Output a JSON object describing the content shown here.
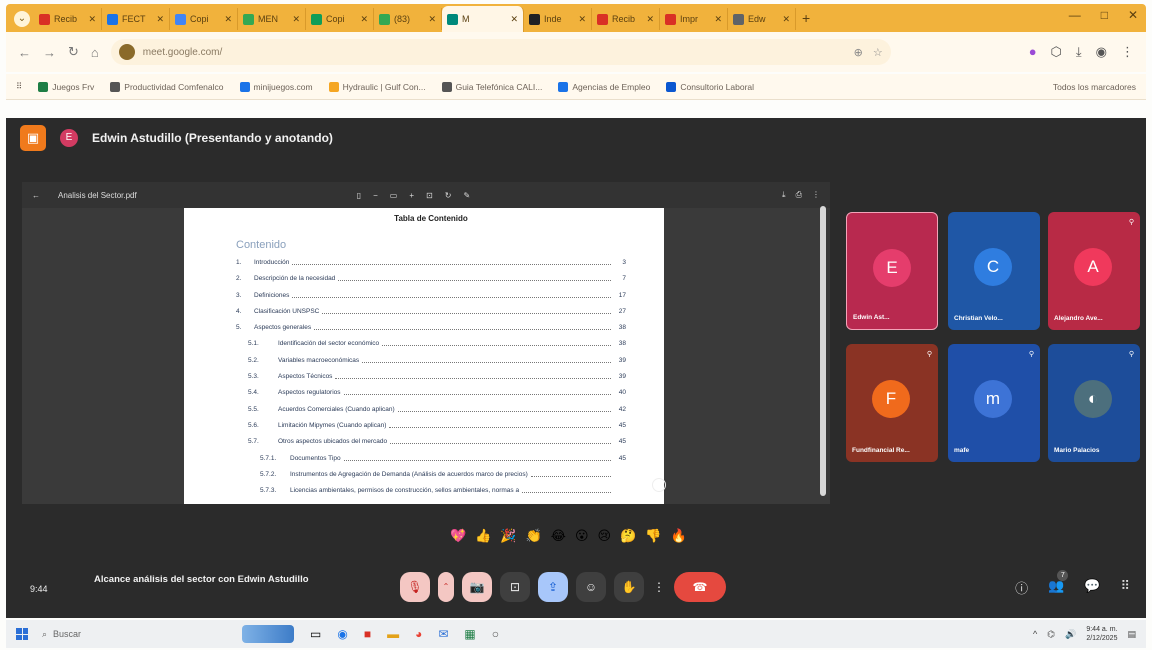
{
  "browser": {
    "tabs": [
      {
        "title": "Recib",
        "color": "#d93025"
      },
      {
        "title": "FECT",
        "color": "#1a73e8"
      },
      {
        "title": "Copi",
        "color": "#4285f4"
      },
      {
        "title": "MEN",
        "color": "#34a853"
      },
      {
        "title": "Copi",
        "color": "#0f9d58"
      },
      {
        "title": "(83)",
        "color": "#34a853"
      },
      {
        "title": "M",
        "color": "#00897b",
        "active": true
      },
      {
        "title": "Inde",
        "color": "#202124"
      },
      {
        "title": "Recib",
        "color": "#d93025"
      },
      {
        "title": "Impr",
        "color": "#d93025"
      },
      {
        "title": "Edw",
        "color": "#5f6368"
      }
    ],
    "url": "meet.google.com/",
    "bookmarks": [
      "Juegos Frv",
      "Productividad Comfenalco",
      "minijuegos.com",
      "Hydraulic | Gulf Con...",
      "Guia Telefónica CALI...",
      "Agencias de Empleo",
      "Consultorio Laboral"
    ],
    "bookmarks_right": "Todos los marcadores"
  },
  "meet": {
    "presenter": "Edwin Astudillo (Presentando y anotando)",
    "presenter_initial": "E",
    "pdf_title": "Analisis del Sector.pdf",
    "meeting_title": "Alcance análisis del sector con Edwin Astudillo",
    "time": "9:44",
    "reactions": [
      "💖",
      "👍",
      "🎉",
      "👏",
      "😂",
      "😮",
      "😢",
      "🤔",
      "👎",
      "🔥"
    ],
    "people_count": "7"
  },
  "document": {
    "page_title": "Tabla de Contenido",
    "heading": "Contenido",
    "toc": [
      {
        "num": "1.",
        "text": "Introducción",
        "page": "3",
        "level": 1
      },
      {
        "num": "2.",
        "text": "Descripción de la necesidad",
        "page": "7",
        "level": 1
      },
      {
        "num": "3.",
        "text": "Definiciones",
        "page": "17",
        "level": 1
      },
      {
        "num": "4.",
        "text": "Clasificación UNSPSC",
        "page": "27",
        "level": 1
      },
      {
        "num": "5.",
        "text": "Aspectos generales",
        "page": "38",
        "level": 1
      },
      {
        "num": "5.1.",
        "text": "Identificación del sector económico",
        "page": "38",
        "level": 2
      },
      {
        "num": "5.2.",
        "text": "Variables macroeconómicas",
        "page": "39",
        "level": 2
      },
      {
        "num": "5.3.",
        "text": "Aspectos Técnicos",
        "page": "39",
        "level": 2
      },
      {
        "num": "5.4.",
        "text": "Aspectos regulatorios",
        "page": "40",
        "level": 2
      },
      {
        "num": "5.5.",
        "text": "Acuerdos Comerciales (Cuando aplican)",
        "page": "42",
        "level": 2
      },
      {
        "num": "5.6.",
        "text": "Limitación Mipymes (Cuando aplican)",
        "page": "45",
        "level": 2
      },
      {
        "num": "5.7.",
        "text": "Otros aspectos ubicados del mercado",
        "page": "45",
        "level": 2
      },
      {
        "num": "5.7.1.",
        "text": "Documentos Tipo",
        "page": "45",
        "level": 3
      },
      {
        "num": "5.7.2.",
        "text": "Instrumentos de Agregación de Demanda (Análisis de acuerdos marco de precios)",
        "page": "",
        "level": 3
      },
      {
        "num": "5.7.3.",
        "text": "Licencias ambientales, permisos de construcción, sellos ambientales, normas a",
        "page": "",
        "level": 3
      }
    ]
  },
  "participants": [
    {
      "name": "Edwin Ast...",
      "initial": "E",
      "tile_color": "#b8294f",
      "avatar_color": "#e53d6c"
    },
    {
      "name": "Christian Velo...",
      "initial": "C",
      "tile_color": "#1f57a6",
      "avatar_color": "#2f7de0"
    },
    {
      "name": "Alejandro Ave...",
      "initial": "A",
      "tile_color": "#b82a45",
      "avatar_color": "#f0395c"
    },
    {
      "name": "Fundfinancial Re...",
      "initial": "F",
      "tile_color": "#8a3324",
      "avatar_color": "#f06a1c"
    },
    {
      "name": "mafe",
      "initial": "m",
      "tile_color": "#1f4fa8",
      "avatar_color": "#3d73d6"
    },
    {
      "name": "Mario Palacios",
      "initial": "",
      "tile_color": "#1d4d9a",
      "avatar_color": "#4c6f7d"
    }
  ],
  "taskbar": {
    "search_placeholder": "Buscar",
    "clock_time": "9:44 a. m.",
    "clock_date": "2/12/2025"
  },
  "colors": {
    "tab_strip": "#f1b23c",
    "meet_bg": "#2b2b2b",
    "end_call": "#e5493f",
    "present_button": "#f07a1c"
  }
}
